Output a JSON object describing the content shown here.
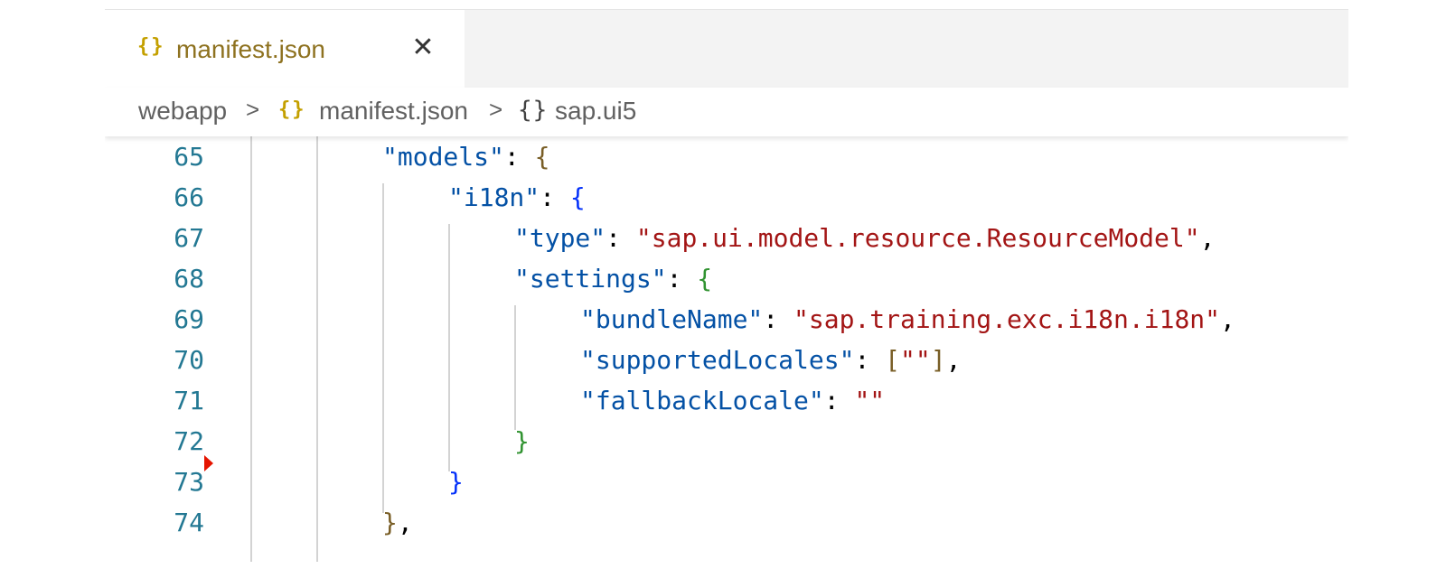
{
  "tab": {
    "icon": "{}",
    "label": "manifest.json",
    "close": "✕"
  },
  "breadcrumb": {
    "items": [
      "webapp",
      "manifest.json",
      "sap.ui5"
    ],
    "separator": ">",
    "icon_json": "{}",
    "icon_object": "{}"
  },
  "code": {
    "line_numbers": [
      "65",
      "66",
      "67",
      "68",
      "69",
      "70",
      "71",
      "72",
      "73",
      "74"
    ],
    "tokens": {
      "models_key": "\"models\"",
      "i18n_key": "\"i18n\"",
      "type_key": "\"type\"",
      "type_value": "\"sap.ui.model.resource.ResourceModel\"",
      "settings_key": "\"settings\"",
      "bundleName_key": "\"bundleName\"",
      "bundleName_value": "\"sap.training.exc.i18n.i18n\"",
      "supportedLocales_key": "\"supportedLocales\"",
      "supportedLocales_value": "\"\"",
      "fallbackLocale_key": "\"fallbackLocale\"",
      "fallbackLocale_value": "\"\"",
      "colon": ": ",
      "comma": ",",
      "brace_open": "{",
      "brace_close": "}",
      "bracket_open": "[",
      "bracket_close": "]"
    }
  },
  "colors": {
    "json_key": "#0451a5",
    "json_string": "#a31515",
    "line_number": "#237893",
    "bracket_level1": "#795e26",
    "bracket_level2": "#0431fa",
    "bracket_level3": "#319331",
    "tab_icon": "#c4a000"
  }
}
